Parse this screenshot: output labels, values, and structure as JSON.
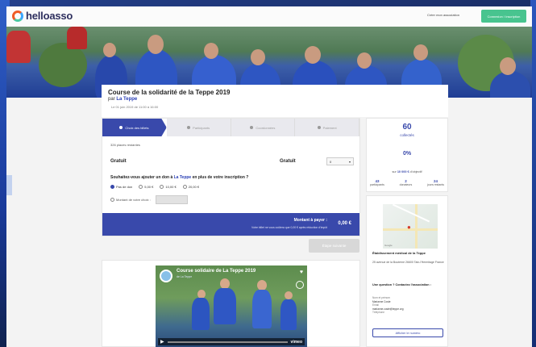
{
  "header": {
    "logo_text": "helloasso",
    "create_label": "Créer mon association",
    "connect_label": "Connexion / Inscription"
  },
  "event": {
    "title": "Course de la solidarité de la Teppe 2019",
    "by": "par",
    "org": "La Teppe",
    "date": "Le 01 juin 2019 de 11:00 à 16:00"
  },
  "steps": [
    {
      "label": "Choix des billets"
    },
    {
      "label": "Participants"
    },
    {
      "label": "Coordonnées"
    },
    {
      "label": "Paiement"
    }
  ],
  "form": {
    "places": "326 places restantes",
    "ticket_name": "Gratuit",
    "ticket_price": "Gratuit",
    "ticket_qty": "0",
    "donation_question_prefix": "Souhaitez-vous ajouter un don à",
    "donation_org": "La Teppe",
    "donation_question_suffix": "en plus de votre inscription ?",
    "options": [
      "Pas de don",
      "5,00 €",
      "10,00 €",
      "20,00 €"
    ],
    "free_amount_label": "Montant de votre choix :",
    "total_label": "Montant à payer :",
    "total_note": "Votre billet ne vous coûtera que 0,00 € après réduction d'impôt",
    "total_amount": "0,00 €",
    "next_label": "Étape suivante"
  },
  "video": {
    "title": "Course solidaire de La Teppe 2019",
    "subtitle": "de La Teppe",
    "brand": "vimeo"
  },
  "stats": {
    "collected_amount": "60",
    "collected_label": "collectés",
    "percent": "0%",
    "goal_prefix": "sur",
    "goal_amount": "10 000 €",
    "goal_suffix": "d'objectif",
    "participants_num": "43",
    "participants_label": "participants",
    "donors_num": "2",
    "donors_label": "donateurs",
    "days_num": "24",
    "days_label": "jours restants"
  },
  "location": {
    "google": "Google",
    "name": "Établissement médical de la Teppe",
    "address": "25 avenue de la Bouterne 26600 Tain-l'Hermitage France",
    "question": "Une question ? Contactez l'association :",
    "contact_name_label": "Nom et prénom",
    "contact_name": "Marianne Coste",
    "contact_email_label": "Email",
    "contact_email": "marianne.coste@teppe.org",
    "phone_label": "Téléphone",
    "phone_button": "Afficher le numéro"
  }
}
